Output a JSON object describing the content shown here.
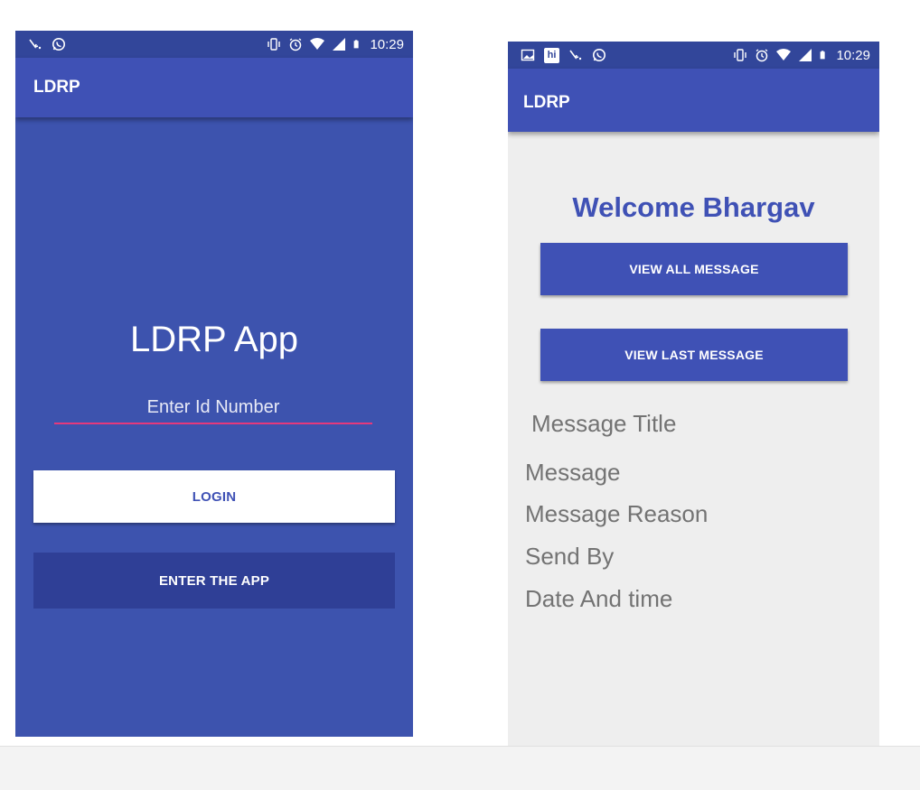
{
  "colors": {
    "primary": "#3f51b5",
    "primary_dark": "#32469a",
    "accent": "#e5397c",
    "background_light": "#eeeeee"
  },
  "status_bar": {
    "time": "10:29",
    "left_icons": [
      "missed-call-icon",
      "whatsapp-icon"
    ],
    "right_icons": [
      "vibrate-icon",
      "alarm-icon",
      "wifi-icon",
      "signal-icon",
      "battery-icon"
    ],
    "right_screen_left_icons": [
      "image-icon",
      "hike-icon",
      "missed-call-icon",
      "whatsapp-icon"
    ],
    "hike_badge": "hi"
  },
  "login_screen": {
    "appbar_title": "LDRP",
    "app_name": "LDRP App",
    "id_placeholder": "Enter Id Number",
    "login_button": "LOGIN",
    "enter_button": "ENTER THE APP"
  },
  "home_screen": {
    "appbar_title": "LDRP",
    "welcome": "Welcome Bhargav",
    "view_all_button": "VIEW ALL MESSAGE",
    "view_last_button": "VIEW LAST MESSAGE",
    "message_title": "Message Title",
    "message": "Message",
    "message_reason": "Message Reason",
    "send_by": "Send By",
    "date_time": "Date And time"
  }
}
